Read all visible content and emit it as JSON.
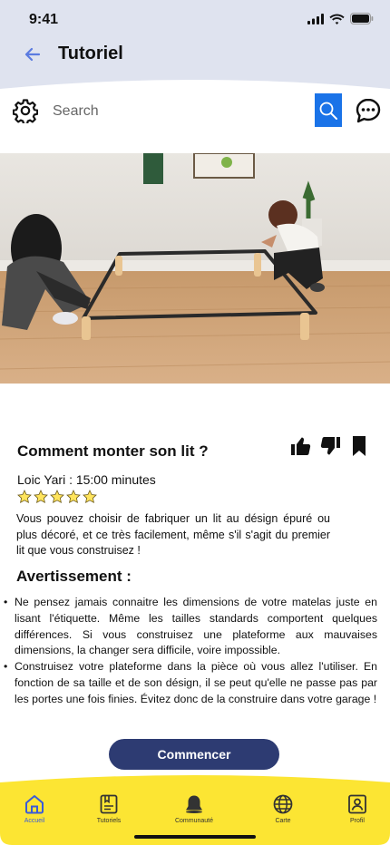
{
  "status_bar": {
    "time": "9:41"
  },
  "header": {
    "title": "Tutoriel",
    "back_icon": "arrow-left-icon"
  },
  "search": {
    "placeholder": "Search"
  },
  "tutorial": {
    "title": "Comment monter son lit ?",
    "author_line": "Loic Yari : 15:00 minutes",
    "rating": 5,
    "rating_max": 5,
    "intro": "Vous pouvez choisir de fabriquer un lit au désign épuré ou plus décoré, et ce très facilement, même s'il s'agit du premier lit que vous construisez !",
    "warning_title": "Avertissement :",
    "warnings": [
      "Ne pensez jamais connaitre les dimensions de votre matelas juste en lisant l'étiquette. Même les tailles standards comportent quelques différences. Si vous construisez une plateforme aux mauvaises dimensions, la changer sera difficile, voire impossible.",
      "Construisez votre plateforme dans la pièce où vous allez l'utiliser. En fonction de sa taille et de son désign, il se peut qu'elle ne passe pas par les portes une fois finies. Évitez donc de la construire dans votre garage !"
    ],
    "start_button": "Commencer"
  },
  "tabbar": {
    "items": [
      {
        "label": "Accueil",
        "icon": "home-icon",
        "active": true
      },
      {
        "label": "Tutoriels",
        "icon": "tutorials-icon",
        "active": false
      },
      {
        "label": "Communauté",
        "icon": "bell-icon",
        "active": false
      },
      {
        "label": "Carte",
        "icon": "globe-icon",
        "active": false
      },
      {
        "label": "Profil",
        "icon": "profile-icon",
        "active": false
      }
    ]
  },
  "colors": {
    "header_bg": "#dfe3ef",
    "accent_blue": "#1a73e8",
    "button_navy": "#2d3b72",
    "tabbar_yellow": "#fce533",
    "star_yellow": "#ffe45c"
  }
}
